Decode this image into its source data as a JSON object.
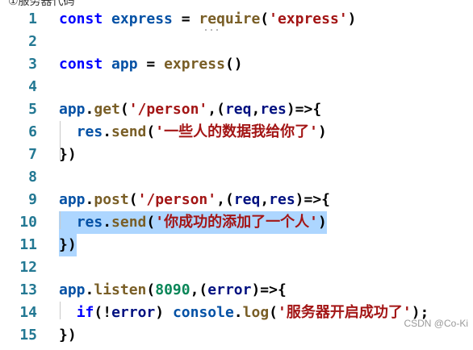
{
  "top_text": "①服务器代码",
  "lines": [
    {
      "num": "1",
      "tokens": [
        [
          "kw",
          "const "
        ],
        [
          "id",
          "express "
        ],
        [
          "punc",
          "= "
        ],
        [
          "fn",
          "require"
        ],
        [
          "punc",
          "("
        ],
        [
          "str",
          "'express'"
        ],
        [
          "punc",
          ")"
        ]
      ]
    },
    {
      "num": "2",
      "tokens": []
    },
    {
      "num": "3",
      "tokens": [
        [
          "kw",
          "const "
        ],
        [
          "id",
          "app "
        ],
        [
          "punc",
          "= "
        ],
        [
          "fn",
          "express"
        ],
        [
          "punc",
          "()"
        ]
      ]
    },
    {
      "num": "4",
      "tokens": []
    },
    {
      "num": "5",
      "tokens": [
        [
          "id",
          "app"
        ],
        [
          "punc",
          "."
        ],
        [
          "fn",
          "get"
        ],
        [
          "punc",
          "("
        ],
        [
          "str",
          "'/person'"
        ],
        [
          "punc",
          ",("
        ],
        [
          "param",
          "req"
        ],
        [
          "punc",
          ","
        ],
        [
          "param",
          "res"
        ],
        [
          "punc",
          ")=>{"
        ]
      ]
    },
    {
      "num": "6",
      "tokens": [
        [
          "punc",
          "  "
        ],
        [
          "id",
          "res"
        ],
        [
          "punc",
          "."
        ],
        [
          "fn",
          "send"
        ],
        [
          "punc",
          "("
        ],
        [
          "str",
          "'一些人的数据我给你了'"
        ],
        [
          "punc",
          ")"
        ]
      ]
    },
    {
      "num": "7",
      "tokens": [
        [
          "punc",
          "})"
        ]
      ]
    },
    {
      "num": "8",
      "tokens": []
    },
    {
      "num": "9",
      "tokens": [
        [
          "id",
          "app"
        ],
        [
          "punc",
          "."
        ],
        [
          "fn",
          "post"
        ],
        [
          "punc",
          "("
        ],
        [
          "str",
          "'/person'"
        ],
        [
          "punc",
          ",("
        ],
        [
          "param",
          "req"
        ],
        [
          "punc",
          ","
        ],
        [
          "param",
          "res"
        ],
        [
          "punc",
          ")=>{"
        ]
      ]
    },
    {
      "num": "10",
      "tokens": [
        [
          "punc",
          "  "
        ],
        [
          "id",
          "res"
        ],
        [
          "punc",
          "."
        ],
        [
          "fn",
          "send"
        ],
        [
          "punc",
          "("
        ],
        [
          "str",
          "'你成功的添加了一个人'"
        ],
        [
          "punc",
          ")"
        ]
      ],
      "selected": true
    },
    {
      "num": "11",
      "tokens": [
        [
          "punc",
          "})"
        ]
      ],
      "selected": true
    },
    {
      "num": "12",
      "tokens": []
    },
    {
      "num": "13",
      "tokens": [
        [
          "id",
          "app"
        ],
        [
          "punc",
          "."
        ],
        [
          "fn",
          "listen"
        ],
        [
          "punc",
          "("
        ],
        [
          "num",
          "8090"
        ],
        [
          "punc",
          ",("
        ],
        [
          "param",
          "error"
        ],
        [
          "punc",
          ")=>{"
        ]
      ]
    },
    {
      "num": "14",
      "tokens": [
        [
          "punc",
          "  "
        ],
        [
          "kw",
          "if"
        ],
        [
          "punc",
          "(!"
        ],
        [
          "param",
          "error"
        ],
        [
          "punc",
          ") "
        ],
        [
          "id",
          "console"
        ],
        [
          "punc",
          "."
        ],
        [
          "fn",
          "log"
        ],
        [
          "punc",
          "("
        ],
        [
          "str",
          "'服务器开启成功了'"
        ],
        [
          "punc",
          ");"
        ]
      ]
    },
    {
      "num": "15",
      "tokens": [
        [
          "punc",
          "})"
        ]
      ]
    }
  ],
  "watermark": "CSDN @Co-Ki"
}
